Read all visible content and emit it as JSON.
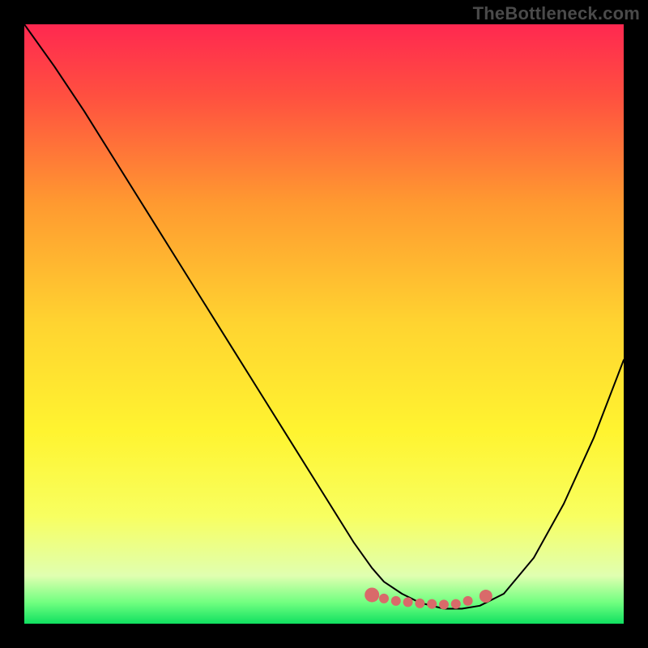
{
  "watermark": "TheBottleneck.com",
  "chart_data": {
    "type": "line",
    "title": "",
    "xlabel": "",
    "ylabel": "",
    "xlim": [
      0,
      100
    ],
    "ylim": [
      0,
      100
    ],
    "grid": false,
    "legend": false,
    "background_gradient_colors": [
      "#ff2850",
      "#ff5040",
      "#ff9a30",
      "#ffd430",
      "#fff430",
      "#f8ff60",
      "#e0ffb0",
      "#70ff80",
      "#10e060"
    ],
    "series": [
      {
        "name": "curve",
        "x": [
          0,
          5,
          10,
          15,
          20,
          25,
          30,
          35,
          40,
          45,
          50,
          55,
          58,
          60,
          63,
          66,
          70,
          73,
          76,
          80,
          85,
          90,
          95,
          100
        ],
        "y": [
          100,
          93,
          85.5,
          77.5,
          69.5,
          61.5,
          53.5,
          45.5,
          37.5,
          29.5,
          21.5,
          13.5,
          9.3,
          7,
          5,
          3.5,
          2.5,
          2.5,
          3,
          5,
          11,
          20,
          31,
          44
        ],
        "stroke": "#000000",
        "stroke_width": 2
      }
    ],
    "markers": {
      "name": "flat-region-markers",
      "color": "#d96a6a",
      "points": [
        {
          "x": 58,
          "y": 4.8
        },
        {
          "x": 60,
          "y": 4.2
        },
        {
          "x": 62,
          "y": 3.8
        },
        {
          "x": 64,
          "y": 3.6
        },
        {
          "x": 66,
          "y": 3.4
        },
        {
          "x": 68,
          "y": 3.3
        },
        {
          "x": 70,
          "y": 3.2
        },
        {
          "x": 72,
          "y": 3.3
        },
        {
          "x": 74,
          "y": 3.8
        },
        {
          "x": 77,
          "y": 4.6
        }
      ],
      "radius_left": 9,
      "radius_mid": 6,
      "radius_right": 8
    }
  }
}
